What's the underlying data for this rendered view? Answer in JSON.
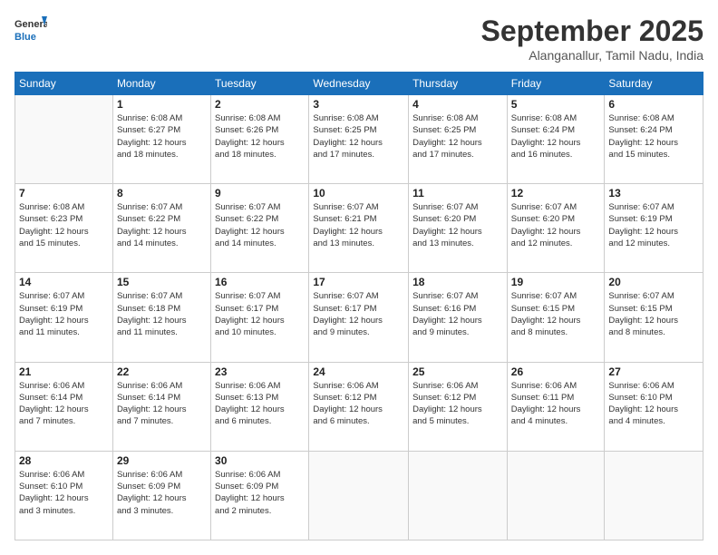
{
  "header": {
    "logo_line1": "General",
    "logo_line2": "Blue",
    "month_title": "September 2025",
    "subtitle": "Alanganallur, Tamil Nadu, India"
  },
  "days_of_week": [
    "Sunday",
    "Monday",
    "Tuesday",
    "Wednesday",
    "Thursday",
    "Friday",
    "Saturday"
  ],
  "weeks": [
    [
      {
        "day": "",
        "info": ""
      },
      {
        "day": "1",
        "info": "Sunrise: 6:08 AM\nSunset: 6:27 PM\nDaylight: 12 hours\nand 18 minutes."
      },
      {
        "day": "2",
        "info": "Sunrise: 6:08 AM\nSunset: 6:26 PM\nDaylight: 12 hours\nand 18 minutes."
      },
      {
        "day": "3",
        "info": "Sunrise: 6:08 AM\nSunset: 6:25 PM\nDaylight: 12 hours\nand 17 minutes."
      },
      {
        "day": "4",
        "info": "Sunrise: 6:08 AM\nSunset: 6:25 PM\nDaylight: 12 hours\nand 17 minutes."
      },
      {
        "day": "5",
        "info": "Sunrise: 6:08 AM\nSunset: 6:24 PM\nDaylight: 12 hours\nand 16 minutes."
      },
      {
        "day": "6",
        "info": "Sunrise: 6:08 AM\nSunset: 6:24 PM\nDaylight: 12 hours\nand 15 minutes."
      }
    ],
    [
      {
        "day": "7",
        "info": "Sunrise: 6:08 AM\nSunset: 6:23 PM\nDaylight: 12 hours\nand 15 minutes."
      },
      {
        "day": "8",
        "info": "Sunrise: 6:07 AM\nSunset: 6:22 PM\nDaylight: 12 hours\nand 14 minutes."
      },
      {
        "day": "9",
        "info": "Sunrise: 6:07 AM\nSunset: 6:22 PM\nDaylight: 12 hours\nand 14 minutes."
      },
      {
        "day": "10",
        "info": "Sunrise: 6:07 AM\nSunset: 6:21 PM\nDaylight: 12 hours\nand 13 minutes."
      },
      {
        "day": "11",
        "info": "Sunrise: 6:07 AM\nSunset: 6:20 PM\nDaylight: 12 hours\nand 13 minutes."
      },
      {
        "day": "12",
        "info": "Sunrise: 6:07 AM\nSunset: 6:20 PM\nDaylight: 12 hours\nand 12 minutes."
      },
      {
        "day": "13",
        "info": "Sunrise: 6:07 AM\nSunset: 6:19 PM\nDaylight: 12 hours\nand 12 minutes."
      }
    ],
    [
      {
        "day": "14",
        "info": "Sunrise: 6:07 AM\nSunset: 6:19 PM\nDaylight: 12 hours\nand 11 minutes."
      },
      {
        "day": "15",
        "info": "Sunrise: 6:07 AM\nSunset: 6:18 PM\nDaylight: 12 hours\nand 11 minutes."
      },
      {
        "day": "16",
        "info": "Sunrise: 6:07 AM\nSunset: 6:17 PM\nDaylight: 12 hours\nand 10 minutes."
      },
      {
        "day": "17",
        "info": "Sunrise: 6:07 AM\nSunset: 6:17 PM\nDaylight: 12 hours\nand 9 minutes."
      },
      {
        "day": "18",
        "info": "Sunrise: 6:07 AM\nSunset: 6:16 PM\nDaylight: 12 hours\nand 9 minutes."
      },
      {
        "day": "19",
        "info": "Sunrise: 6:07 AM\nSunset: 6:15 PM\nDaylight: 12 hours\nand 8 minutes."
      },
      {
        "day": "20",
        "info": "Sunrise: 6:07 AM\nSunset: 6:15 PM\nDaylight: 12 hours\nand 8 minutes."
      }
    ],
    [
      {
        "day": "21",
        "info": "Sunrise: 6:06 AM\nSunset: 6:14 PM\nDaylight: 12 hours\nand 7 minutes."
      },
      {
        "day": "22",
        "info": "Sunrise: 6:06 AM\nSunset: 6:14 PM\nDaylight: 12 hours\nand 7 minutes."
      },
      {
        "day": "23",
        "info": "Sunrise: 6:06 AM\nSunset: 6:13 PM\nDaylight: 12 hours\nand 6 minutes."
      },
      {
        "day": "24",
        "info": "Sunrise: 6:06 AM\nSunset: 6:12 PM\nDaylight: 12 hours\nand 6 minutes."
      },
      {
        "day": "25",
        "info": "Sunrise: 6:06 AM\nSunset: 6:12 PM\nDaylight: 12 hours\nand 5 minutes."
      },
      {
        "day": "26",
        "info": "Sunrise: 6:06 AM\nSunset: 6:11 PM\nDaylight: 12 hours\nand 4 minutes."
      },
      {
        "day": "27",
        "info": "Sunrise: 6:06 AM\nSunset: 6:10 PM\nDaylight: 12 hours\nand 4 minutes."
      }
    ],
    [
      {
        "day": "28",
        "info": "Sunrise: 6:06 AM\nSunset: 6:10 PM\nDaylight: 12 hours\nand 3 minutes."
      },
      {
        "day": "29",
        "info": "Sunrise: 6:06 AM\nSunset: 6:09 PM\nDaylight: 12 hours\nand 3 minutes."
      },
      {
        "day": "30",
        "info": "Sunrise: 6:06 AM\nSunset: 6:09 PM\nDaylight: 12 hours\nand 2 minutes."
      },
      {
        "day": "",
        "info": ""
      },
      {
        "day": "",
        "info": ""
      },
      {
        "day": "",
        "info": ""
      },
      {
        "day": "",
        "info": ""
      }
    ]
  ]
}
